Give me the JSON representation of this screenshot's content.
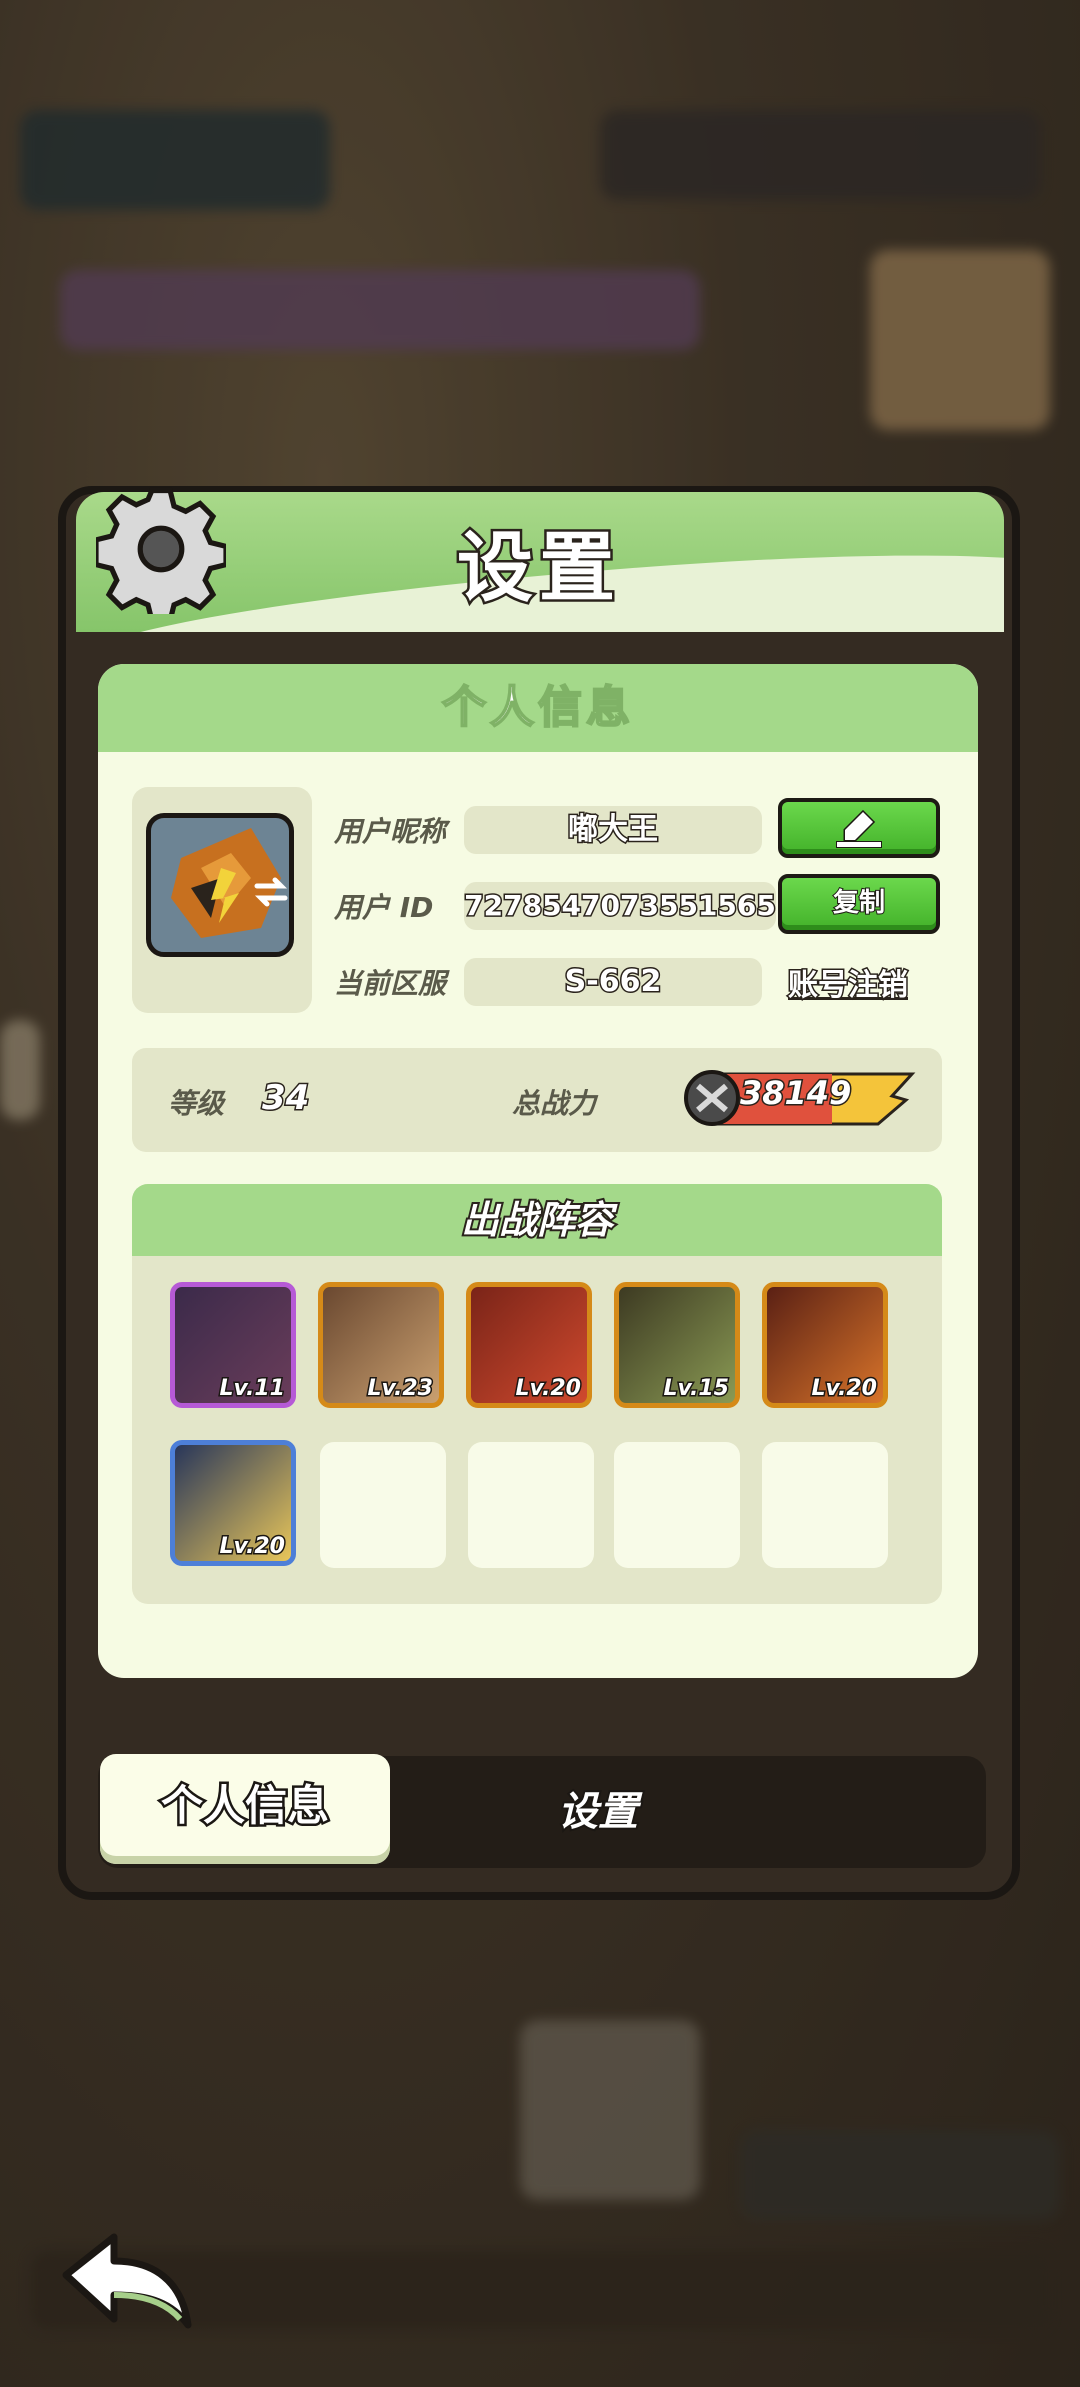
{
  "dialog": {
    "title": "设置",
    "section_title": "个人信息",
    "nickname_label": "用户昵称",
    "nickname_value": "嘟大王",
    "userid_label": "用户 ID",
    "userid_value": "7278547073551565",
    "server_label": "当前区服",
    "server_value": "S-662",
    "copy_label": "复制",
    "deactivate_link": "账号注销",
    "level_label": "等级",
    "level_value": "34",
    "power_label": "总战力",
    "power_value": "38149",
    "lineup_title": "出战阵容",
    "heroes": [
      {
        "level": "Lv.11",
        "rarity": "purple"
      },
      {
        "level": "Lv.23",
        "rarity": "orange"
      },
      {
        "level": "Lv.20",
        "rarity": "orange"
      },
      {
        "level": "Lv.15",
        "rarity": "orange"
      },
      {
        "level": "Lv.20",
        "rarity": "orange"
      },
      {
        "level": "Lv.20",
        "rarity": "blue"
      }
    ]
  },
  "tabs": {
    "active": "个人信息",
    "other": "设置"
  },
  "colors": {
    "accent_green": "#86c56a",
    "card_bg": "#f6fbe3",
    "panel_dark": "#342b22"
  }
}
